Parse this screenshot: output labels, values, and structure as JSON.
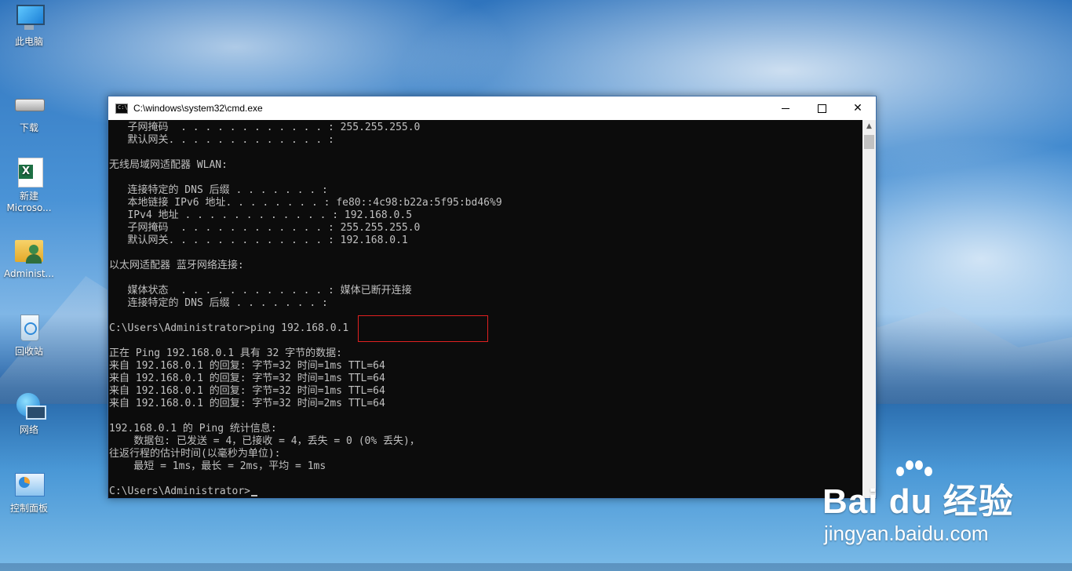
{
  "desktop": {
    "icons": [
      {
        "label": "此电脑",
        "icon": "computer-icon"
      },
      {
        "label": "下载",
        "icon": "drive-icon"
      },
      {
        "label": "新建\nMicroso...",
        "label_line1": "新建",
        "label_line2": "Microso...",
        "icon": "excel-file-icon"
      },
      {
        "label": "Administ...",
        "icon": "user-folder-icon"
      },
      {
        "label": "回收站",
        "icon": "recycle-bin-icon"
      },
      {
        "label": "网络",
        "icon": "network-icon"
      },
      {
        "label": "控制面板",
        "icon": "control-panel-icon"
      }
    ]
  },
  "window": {
    "title": "C:\\windows\\system32\\cmd.exe",
    "title_icon_text": "C:\\",
    "minimize_label": "minimize",
    "maximize_label": "maximize",
    "close_label": "✕"
  },
  "console": {
    "lines": [
      "   子网掩码  . . . . . . . . . . . . : 255.255.255.0",
      "   默认网关. . . . . . . . . . . . . :",
      "",
      "无线局域网适配器 WLAN:",
      "",
      "   连接特定的 DNS 后缀 . . . . . . . :",
      "   本地链接 IPv6 地址. . . . . . . . : fe80::4c98:b22a:5f95:bd46%9",
      "   IPv4 地址 . . . . . . . . . . . . : 192.168.0.5",
      "   子网掩码  . . . . . . . . . . . . : 255.255.255.0",
      "   默认网关. . . . . . . . . . . . . : 192.168.0.1",
      "",
      "以太网适配器 蓝牙网络连接:",
      "",
      "   媒体状态  . . . . . . . . . . . . : 媒体已断开连接",
      "   连接特定的 DNS 后缀 . . . . . . . :",
      "",
      "C:\\Users\\Administrator>ping 192.168.0.1",
      "",
      "正在 Ping 192.168.0.1 具有 32 字节的数据:",
      "来自 192.168.0.1 的回复: 字节=32 时间=1ms TTL=64",
      "来自 192.168.0.1 的回复: 字节=32 时间=1ms TTL=64",
      "来自 192.168.0.1 的回复: 字节=32 时间=1ms TTL=64",
      "来自 192.168.0.1 的回复: 字节=32 时间=2ms TTL=64",
      "",
      "192.168.0.1 的 Ping 统计信息:",
      "    数据包: 已发送 = 4，已接收 = 4，丢失 = 0 (0% 丢失)，",
      "往返行程的估计时间(以毫秒为单位):",
      "    最短 = 1ms，最长 = 2ms，平均 = 1ms",
      "",
      "C:\\Users\\Administrator>"
    ],
    "highlighted_command": "ping 192.168.0.1"
  },
  "watermark": {
    "brand": "Bai du 经验",
    "url": "jingyan.baidu.com"
  }
}
